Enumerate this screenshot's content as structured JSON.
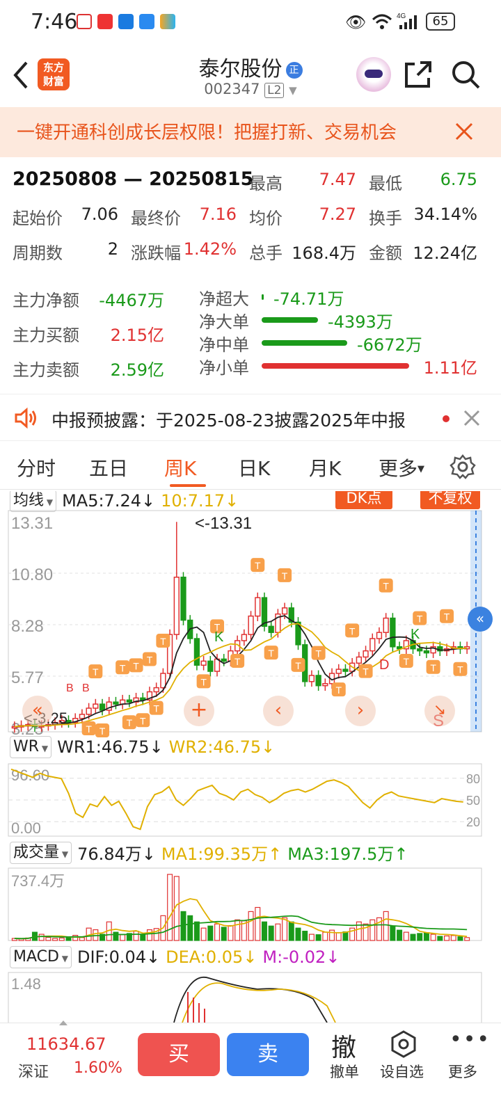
{
  "status": {
    "time": "7:46",
    "battery": "65"
  },
  "header": {
    "logo_line1": "东方",
    "logo_line2": "财富",
    "stock_name": "泰尔股份",
    "zheng_badge": "正",
    "stock_code": "002347",
    "level": "L2"
  },
  "banner": {
    "text": "一键开通科创成长层权限！把握打新、交易机会"
  },
  "stats": {
    "range": "20250808 — 20250815",
    "rows": [
      [
        {
          "label": "最高",
          "value": "7.47",
          "color": "red"
        },
        {
          "label": "最低",
          "value": "6.75",
          "color": "green"
        }
      ],
      [
        {
          "label": "起始价",
          "value": "7.06",
          "color": "black"
        },
        {
          "label": "最终价",
          "value": "7.16",
          "color": "red"
        },
        {
          "label": "均价",
          "value": "7.27",
          "color": "red"
        },
        {
          "label": "换手",
          "value": "34.14%",
          "color": "black"
        }
      ],
      [
        {
          "label": "周期数",
          "value": "2",
          "color": "black"
        },
        {
          "label": "涨跌幅",
          "value": "1.42%",
          "color": "red"
        },
        {
          "label": "总手",
          "value": "168.4万",
          "color": "black"
        },
        {
          "label": "金额",
          "value": "12.24亿",
          "color": "black"
        }
      ]
    ]
  },
  "flow": {
    "left": [
      {
        "label": "主力净额",
        "value": "-4467万",
        "color": "green"
      },
      {
        "label": "主力买额",
        "value": "2.15亿",
        "color": "red"
      },
      {
        "label": "主力卖额",
        "value": "2.59亿",
        "color": "green"
      }
    ],
    "right": [
      {
        "label": "净超大",
        "value": "-74.71万",
        "color": "green",
        "bar_fraction": 0.01
      },
      {
        "label": "净大单",
        "value": "-4393万",
        "color": "green",
        "bar_fraction": 0.38
      },
      {
        "label": "净中单",
        "value": "-6672万",
        "color": "green",
        "bar_fraction": 0.58
      },
      {
        "label": "净小单",
        "value": "1.11亿",
        "color": "red",
        "bar_fraction": 1.0
      }
    ]
  },
  "notice": {
    "text": "中报预披露：于2025-08-23披露2025年中报"
  },
  "tabs": [
    {
      "label": "分时",
      "active": false
    },
    {
      "label": "五日",
      "active": false
    },
    {
      "label": "周K",
      "active": true
    },
    {
      "label": "日K",
      "active": false
    },
    {
      "label": "月K",
      "active": false
    },
    {
      "label": "更多",
      "active": false
    }
  ],
  "kline": {
    "ma_selector": "均线",
    "ma5": "MA5:7.24",
    "ma10": "10:7.17",
    "dk_button": "DK点",
    "fq_button": "不复权",
    "y_labels": [
      "13.31",
      "10.80",
      "8.28",
      "5.77",
      "3.25"
    ],
    "max_annotation": "<-13.31",
    "min_annotation": "<-3.25",
    "signal_T": "T",
    "signal_K": "K",
    "signal_D": "D",
    "signal_S": "S",
    "signal_B": "B"
  },
  "wr": {
    "selector": "WR",
    "wr1": "WR1:46.75",
    "wr2": "WR2:46.75",
    "y_top": "96.60",
    "y_bottom": "0.00",
    "r80": "80",
    "r50": "50",
    "r20": "20"
  },
  "volume": {
    "selector": "成交量",
    "value": "76.84万",
    "ma1": "MA1:99.35万",
    "ma3": "MA3:197.5万",
    "y_top": "737.4万"
  },
  "macd": {
    "selector": "MACD",
    "dif": "DIF:0.04",
    "dea": "DEA:0.05",
    "m": "M:-0.02",
    "y_top": "1.48"
  },
  "bottom": {
    "index_value": "11634.67",
    "index_name": "深证",
    "index_change": "1.60%",
    "buy": "买",
    "sell": "卖",
    "cancel_glyph": "撤",
    "cancel_label": "撤单",
    "watch_label": "设自选",
    "more_label": "更多"
  },
  "colors": {
    "up": "#e03131",
    "down": "#1a9a1a",
    "accent": "#f15a22",
    "ma_yellow": "#e0b000",
    "ma_black": "#222222"
  },
  "arrows": {
    "down": "↓",
    "up": "↑"
  }
}
